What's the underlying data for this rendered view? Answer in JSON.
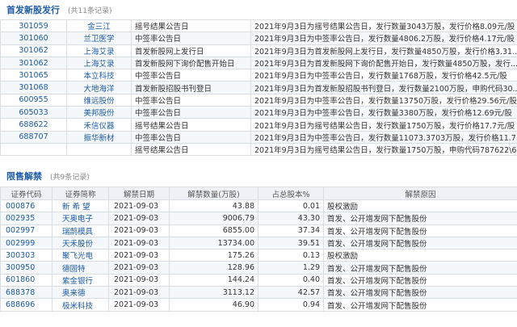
{
  "ipo_section": {
    "title": "首发新股发行",
    "count": "(共11条记录)",
    "rows": [
      {
        "code": "301059",
        "name": "金三江",
        "event": "摇号结果公告日",
        "detail": "2021年9月3日为摇号结果公告日，发行数量3043万股，发行价格8.09元/股"
      },
      {
        "code": "301060",
        "name": "兰卫医学",
        "event": "中签率公告日",
        "detail": "2021年9月3日为中签率公告日，发行数量4806.2万股，发行价格4.17元/股"
      },
      {
        "code": "301062",
        "name": "上海艾录",
        "event": "首发新股网上发行日",
        "detail": "2021年9月3日为首发新股网上发行日，发行数量4850万股，发行价格3.31..."
      },
      {
        "code": "301062",
        "name": "上海艾录",
        "event": "首发新股网下询价配售开始日",
        "detail": "2021年9月3日为首发新股网下询价配售开始日，发行数量4850万股，发行..."
      },
      {
        "code": "301065",
        "name": "本立科技",
        "event": "中签率公告日",
        "detail": "2021年9月3日为中签率公告日，发行数量1768万股，发行价格42.5元/股"
      },
      {
        "code": "301068",
        "name": "大地海洋",
        "event": "首发新股招股书刊登日",
        "detail": "2021年9月3日为首发新股招股书刊登日，发行数量2100万股，申购代码30..."
      },
      {
        "code": "600955",
        "name": "维远股份",
        "event": "中签率公告日",
        "detail": "2021年9月3日为中签率公告日，发行数量13750万股，发行价格29.56元/股"
      },
      {
        "code": "605033",
        "name": "美邦股份",
        "event": "中签率公告日",
        "detail": "2021年9月3日为中签率公告日，发行数量3380万股，发行价格12.69元/股"
      },
      {
        "code": "688622",
        "name": "禾信仪器",
        "event": "摇号结果公告日",
        "detail": "2021年9月3日为摇号结果公告日，发行数量1750万股，发行价格17.7元/股"
      },
      {
        "code": "688707",
        "name": "振华新材",
        "event": "中签率公告日",
        "detail": "2021年9月3日为中签率公告日，发行数量11073.3703万股，发行价格11.7..."
      },
      {
        "code": "",
        "name": "",
        "event": "摇号结果公告日",
        "detail": "2021年9月3日为摇号结果公告日，发行数量1750万股，申购代码787622\\6..."
      }
    ]
  },
  "ban_section": {
    "title": "限售解禁",
    "count": "(共9条记录)",
    "headers": [
      "证券代码",
      "证券简称",
      "解禁日期",
      "解禁数量(万股)",
      "占总股本%",
      "解禁原因"
    ],
    "rows": [
      {
        "code": "000876",
        "name": "新 希 望",
        "date": "2021-09-03",
        "qty": "43.88",
        "pct": "0.01",
        "reason": "股权激励"
      },
      {
        "code": "002935",
        "name": "天奥电子",
        "date": "2021-09-03",
        "qty": "9006.79",
        "pct": "43.30",
        "reason": "首发、公开增发网下配售股份"
      },
      {
        "code": "002997",
        "name": "瑞鹄模具",
        "date": "2021-09-03",
        "qty": "6855.00",
        "pct": "37.34",
        "reason": "首发、公开增发网下配售股份"
      },
      {
        "code": "002999",
        "name": "天禾股份",
        "date": "2021-09-03",
        "qty": "13734.00",
        "pct": "39.51",
        "reason": "首发、公开增发网下配售股份"
      },
      {
        "code": "300303",
        "name": "聚飞光电",
        "date": "2021-09-03",
        "qty": "175.26",
        "pct": "0.13",
        "reason": "股权激励"
      },
      {
        "code": "300950",
        "name": "德固特",
        "date": "2021-09-03",
        "qty": "128.96",
        "pct": "1.29",
        "reason": "首发、公开增发网下配售股份"
      },
      {
        "code": "601860",
        "name": "紫金银行",
        "date": "2021-09-03",
        "qty": "144.24",
        "pct": "0.40",
        "reason": "首发、公开增发网下配售股份"
      },
      {
        "code": "688378",
        "name": "奥来德",
        "date": "2021-09-03",
        "qty": "3113.12",
        "pct": "42.57",
        "reason": "首发、公开增发网下配售股份"
      },
      {
        "code": "688696",
        "name": "极米科技",
        "date": "2021-09-03",
        "qty": "46.90",
        "pct": "0.94",
        "reason": "首发、公开增发网下配售股份"
      }
    ]
  }
}
